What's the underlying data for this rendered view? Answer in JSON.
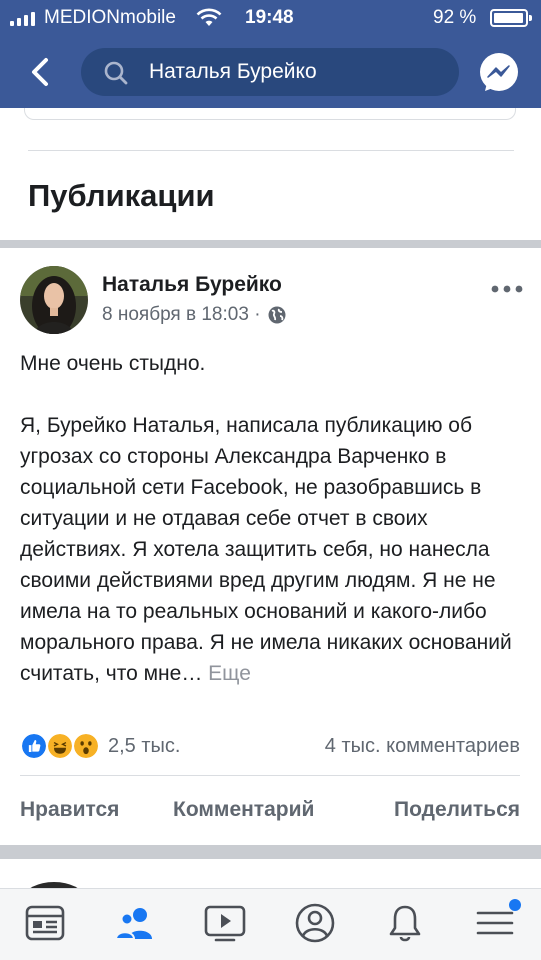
{
  "status_bar": {
    "carrier": "MEDIONmobile",
    "time": "19:48",
    "battery": "92 %",
    "battery_level": 0.92
  },
  "header": {
    "back_icon": "chevron-left-icon",
    "search_icon": "search-icon",
    "search_query": "Наталья Бурейко",
    "messenger_icon": "messenger-icon"
  },
  "section": {
    "title": "Публикации"
  },
  "post": {
    "author": "Наталья Бурейко",
    "date": "8 ноября в 18:03 ·",
    "privacy_icon": "globe-icon",
    "more_icon": "more-dots-icon",
    "text": "Мне очень стыдно.\n\nЯ, Бурейко Наталья, написала публикацию об угрозах со стороны Александра Варченко в социальной сети Facebook, не разобравшись в ситуации и не отдавая себе отчет в своих действиях. Я хотела защитить себя, но нанесла своими действиями вред другим людям. Я не не имела на то реальных оснований и какого-либо морального права. Я не имела никаких оснований считать, что мне…",
    "see_more": "Еще",
    "reactions": {
      "icons": [
        "like-icon",
        "haha-icon",
        "wow-icon"
      ],
      "count": "2,5 тыс.",
      "comments": "4 тыс. комментариев"
    },
    "actions": {
      "like": "Нравится",
      "comment": "Комментарий",
      "share": "Поделиться"
    }
  },
  "tabbar": {
    "tabs": [
      "news-feed-icon",
      "friends-icon",
      "watch-icon",
      "profile-icon",
      "notifications-icon",
      "menu-icon"
    ],
    "active": "friends-icon"
  },
  "colors": {
    "brand": "#3b5998",
    "search_bg": "#29487d",
    "active_tab": "#1877f2",
    "muted_text": "#606770",
    "like": "#1877f2",
    "emoji": "#f7b125"
  }
}
